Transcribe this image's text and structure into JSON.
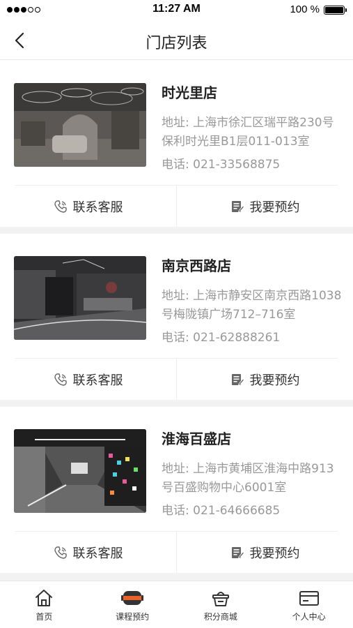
{
  "status_bar": {
    "time": "11:27 AM",
    "battery_text": "100 %"
  },
  "nav": {
    "title": "门店列表"
  },
  "stores": [
    {
      "name": "时光里店",
      "address": "地址: 上海市徐汇区瑞平路230号保利时光里B1层011-013室",
      "phone": "电话: 021-33568875",
      "contact_label": "联系客服",
      "book_label": "我要预约"
    },
    {
      "name": "南京西路店",
      "address": "地址: 上海市静安区南京西路1038号梅陇镇广场712–716室",
      "phone": "电话: 021-62888261",
      "contact_label": "联系客服",
      "book_label": "我要预约"
    },
    {
      "name": "淮海百盛店",
      "address": "地址: 上海市黄埔区淮海中路913号百盛购物中心6001室",
      "phone": "电话: 021-64666685",
      "contact_label": "联系客服",
      "book_label": "我要预约"
    }
  ],
  "tabs": [
    {
      "label": "首页",
      "icon": "home-icon"
    },
    {
      "label": "课程预约",
      "icon": "vr-headset-icon",
      "accent": "#e8622a"
    },
    {
      "label": "积分商城",
      "icon": "shopping-basket-icon"
    },
    {
      "label": "个人中心",
      "icon": "card-icon"
    }
  ]
}
